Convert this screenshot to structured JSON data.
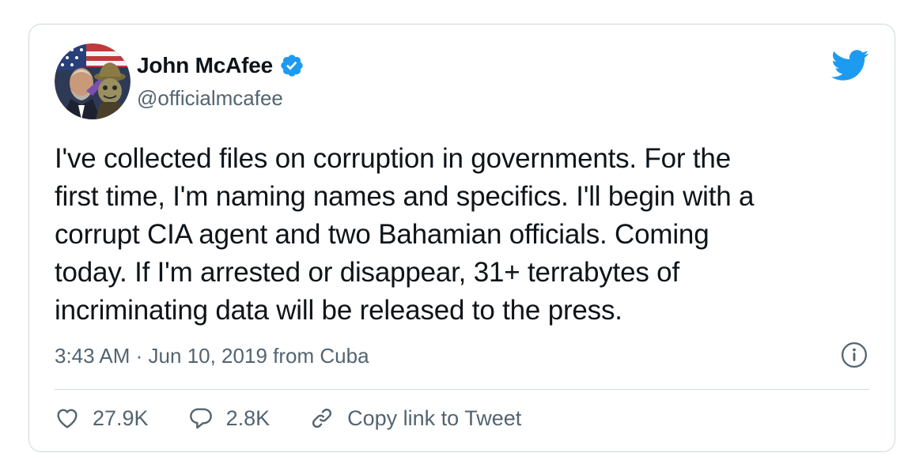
{
  "user": {
    "display_name": "John McAfee",
    "handle": "@officialmcafee",
    "verified_icon": "verified-badge-icon",
    "avatar_icon": "profile-avatar"
  },
  "brand": {
    "icon": "twitter-bird-icon",
    "color": "#1d9bf0"
  },
  "tweet": {
    "lines": [
      "I've collected files on corruption in governments. For the",
      "first time, I'm naming names and specifics. I'll begin with a",
      "corrupt CIA agent and two Bahamian officials. Coming",
      "today. If I'm arrested or disappear, 31+ terrabytes of",
      "incriminating data will be released to the press."
    ]
  },
  "meta": {
    "time": "3:43 AM",
    "separator": "·",
    "date": "Jun 10, 2019",
    "from_text": "from",
    "location": "Cuba",
    "info_icon": "info-icon"
  },
  "actions": {
    "likes": {
      "icon": "heart-icon",
      "count": "27.9K"
    },
    "replies": {
      "icon": "reply-bubble-icon",
      "count": "2.8K"
    },
    "copy_link": {
      "icon": "link-icon",
      "label": "Copy link to Tweet"
    }
  },
  "colors": {
    "text_primary": "#0f1419",
    "text_secondary": "#536471",
    "border": "#cfd9de",
    "accent": "#1d9bf0"
  }
}
